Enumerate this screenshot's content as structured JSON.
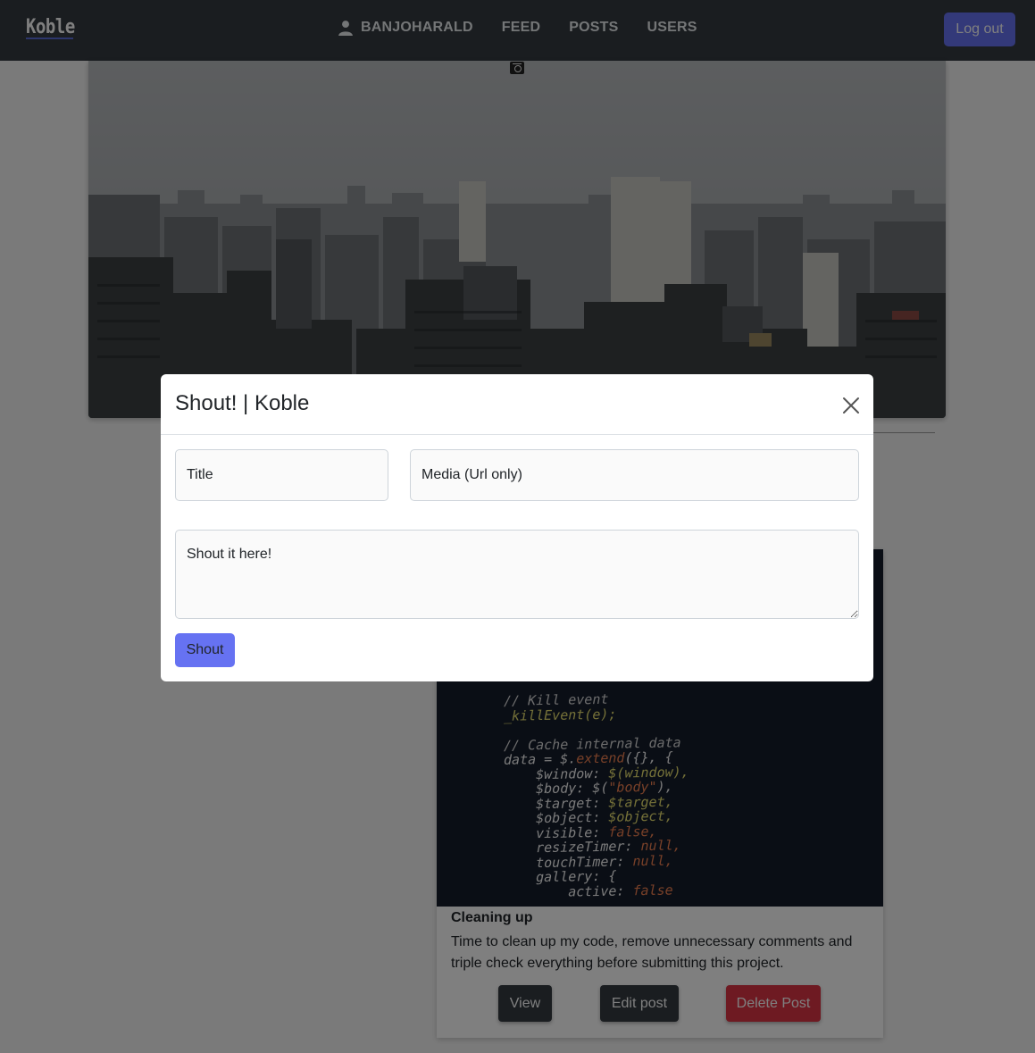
{
  "nav": {
    "brand": "Koble",
    "links": [
      {
        "label": "BANJOHARALD",
        "icon": "user-icon"
      },
      {
        "label": "FEED"
      },
      {
        "label": "POSTS"
      },
      {
        "label": "USERS"
      }
    ],
    "logout_label": "Log out"
  },
  "colors": {
    "navbar": "#343a40",
    "accent": "#6672f2",
    "danger": "#dc3545"
  },
  "post": {
    "title": "Cleaning up",
    "text": "Time to clean up my code, remove unnecessary comments and triple check everything before submitting this project.",
    "view_label": "View",
    "edit_label": "Edit post",
    "delete_label": "Delete Post"
  },
  "modal": {
    "title": "Shout! | Koble",
    "title_placeholder": "Title",
    "media_placeholder": "Media (Url only)",
    "body_placeholder": "Shout it here!",
    "submit_label": "Shout"
  }
}
